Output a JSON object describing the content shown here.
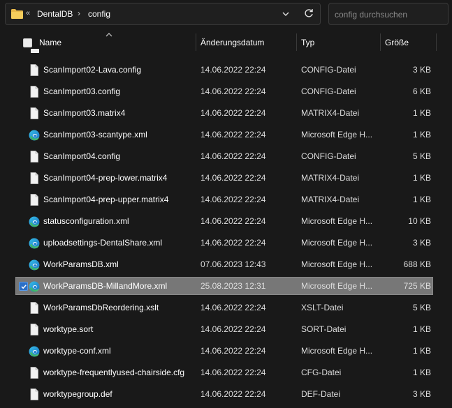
{
  "addressbar": {
    "back_marker": "«",
    "crumbs": [
      "DentalDB",
      "config"
    ],
    "chevron": "›"
  },
  "search": {
    "placeholder": "config durchsuchen",
    "value": ""
  },
  "columns": {
    "name": "Name",
    "date": "Änderungsdatum",
    "type": "Typ",
    "size": "Größe"
  },
  "files": [
    {
      "name": "ScanImport02-Lava.config",
      "date": "14.06.2022 22:24",
      "type": "CONFIG-Datei",
      "size": "3 KB",
      "icon": "document-icon",
      "selected": false
    },
    {
      "name": "ScanImport03.config",
      "date": "14.06.2022 22:24",
      "type": "CONFIG-Datei",
      "size": "6 KB",
      "icon": "document-icon",
      "selected": false
    },
    {
      "name": "ScanImport03.matrix4",
      "date": "14.06.2022 22:24",
      "type": "MATRIX4-Datei",
      "size": "1 KB",
      "icon": "document-icon",
      "selected": false
    },
    {
      "name": "ScanImport03-scantype.xml",
      "date": "14.06.2022 22:24",
      "type": "Microsoft Edge H...",
      "size": "1 KB",
      "icon": "edge-icon",
      "selected": false
    },
    {
      "name": "ScanImport04.config",
      "date": "14.06.2022 22:24",
      "type": "CONFIG-Datei",
      "size": "5 KB",
      "icon": "document-icon",
      "selected": false
    },
    {
      "name": "ScanImport04-prep-lower.matrix4",
      "date": "14.06.2022 22:24",
      "type": "MATRIX4-Datei",
      "size": "1 KB",
      "icon": "document-icon",
      "selected": false
    },
    {
      "name": "ScanImport04-prep-upper.matrix4",
      "date": "14.06.2022 22:24",
      "type": "MATRIX4-Datei",
      "size": "1 KB",
      "icon": "document-icon",
      "selected": false
    },
    {
      "name": "statusconfiguration.xml",
      "date": "14.06.2022 22:24",
      "type": "Microsoft Edge H...",
      "size": "10 KB",
      "icon": "edge-icon",
      "selected": false
    },
    {
      "name": "uploadsettings-DentalShare.xml",
      "date": "14.06.2022 22:24",
      "type": "Microsoft Edge H...",
      "size": "3 KB",
      "icon": "edge-icon",
      "selected": false
    },
    {
      "name": "WorkParamsDB.xml",
      "date": "07.06.2023 12:43",
      "type": "Microsoft Edge H...",
      "size": "688 KB",
      "icon": "edge-icon",
      "selected": false
    },
    {
      "name": "WorkParamsDB-MillandMore.xml",
      "date": "25.08.2023 12:31",
      "type": "Microsoft Edge H...",
      "size": "725 KB",
      "icon": "edge-icon",
      "selected": true
    },
    {
      "name": "WorkParamsDbReordering.xslt",
      "date": "14.06.2022 22:24",
      "type": "XSLT-Datei",
      "size": "5 KB",
      "icon": "document-icon",
      "selected": false
    },
    {
      "name": "worktype.sort",
      "date": "14.06.2022 22:24",
      "type": "SORT-Datei",
      "size": "1 KB",
      "icon": "document-icon",
      "selected": false
    },
    {
      "name": "worktype-conf.xml",
      "date": "14.06.2022 22:24",
      "type": "Microsoft Edge H...",
      "size": "1 KB",
      "icon": "edge-icon",
      "selected": false
    },
    {
      "name": "worktype-frequentlyused-chairside.cfg",
      "date": "14.06.2022 22:24",
      "type": "CFG-Datei",
      "size": "1 KB",
      "icon": "document-icon",
      "selected": false
    },
    {
      "name": "worktypegroup.def",
      "date": "14.06.2022 22:24",
      "type": "DEF-Datei",
      "size": "3 KB",
      "icon": "document-icon",
      "selected": false
    }
  ]
}
